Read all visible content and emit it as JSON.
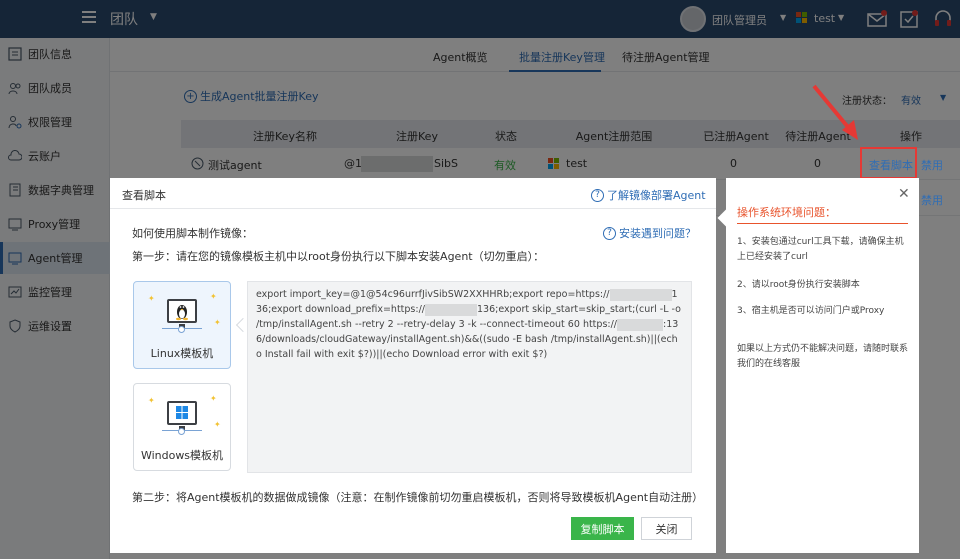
{
  "topbar": {
    "title": "团队",
    "user": "团队管理员",
    "project": "test"
  },
  "sidebar": {
    "items": [
      {
        "label": "团队信息",
        "icon": "team-info-icon"
      },
      {
        "label": "团队成员",
        "icon": "team-members-icon"
      },
      {
        "label": "权限管理",
        "icon": "permission-icon"
      },
      {
        "label": "云账户",
        "icon": "cloud-account-icon"
      },
      {
        "label": "数据字典管理",
        "icon": "data-dictionary-icon"
      },
      {
        "label": "Proxy管理",
        "icon": "proxy-icon"
      },
      {
        "label": "Agent管理",
        "icon": "agent-icon"
      },
      {
        "label": "监控管理",
        "icon": "monitor-icon"
      },
      {
        "label": "运维设置",
        "icon": "ops-settings-icon"
      }
    ]
  },
  "tabs": [
    "Agent概览",
    "批量注册Key管理",
    "待注册Agent管理"
  ],
  "toolbar": {
    "generate_key": "生成Agent批量注册Key",
    "filter_label": "注册状态：",
    "filter_value": "有效"
  },
  "table": {
    "headers": [
      "注册Key名称",
      "注册Key",
      "状态",
      "Agent注册范围",
      "已注册Agent",
      "待注册Agent",
      "操作"
    ],
    "rows": [
      {
        "name": "测试agent",
        "key_prefix": "@1",
        "key_suffix": "SibS",
        "status": "有效",
        "scope": "test",
        "registered": "0",
        "pending": "0",
        "view": "查看脚本",
        "disable": "禁用"
      },
      {
        "disable": "禁用"
      }
    ]
  },
  "dialog": {
    "title": "查看脚本",
    "help_link": "了解镜像部署Agent",
    "how_label": "如何使用脚本制作镜像：",
    "install_issue": "安装遇到问题？",
    "step1": "第一步：请在您的镜像模板主机中以root身份执行以下脚本安装Agent（切勿重启）：",
    "templates": [
      {
        "label": "Linux模板机",
        "icon": "linux-icon"
      },
      {
        "label": "Windows模板机",
        "icon": "windows-icon"
      }
    ],
    "script_lines": [
      "export import_key=@1@54c96urrfJivSibSW2XXHHRb;export repo=https://",
      "136;export",
      "download_prefix=https://",
      "136;export skip_start=skip_start;(curl -L -o",
      "/tmp/installAgent.sh --retry 2 --retry-delay 3 -k --connect-timeout 60",
      "https://",
      ":136/downloads/cloudGateway/installAgent.sh)&&((sudo -E bash",
      "/tmp/installAgent.sh)||(echo Install fail with exit $?))||(echo Download error with exit $?)"
    ],
    "step2": "第二步：将Agent模板机的数据做成镜像（注意：在制作镜像前切勿重启模板机，否则将导致模板机Agent自动注册）",
    "copy_button": "复制脚本",
    "close_button": "关闭"
  },
  "panel": {
    "title": "操作系统环境问题：",
    "items": [
      "1、安装包通过curl工具下载，请确保主机上已经安装了curl",
      "2、请以root身份执行安装脚本",
      "3、宿主机是否可以访问门户或Proxy"
    ],
    "footer": "如果以上方式仍不能解决问题，请随时联系我们的在线客服"
  },
  "colors": {
    "accent": "#2f6db5",
    "success": "#3ab54a",
    "highlight": "#e53935",
    "panel_title": "#e8532c"
  }
}
